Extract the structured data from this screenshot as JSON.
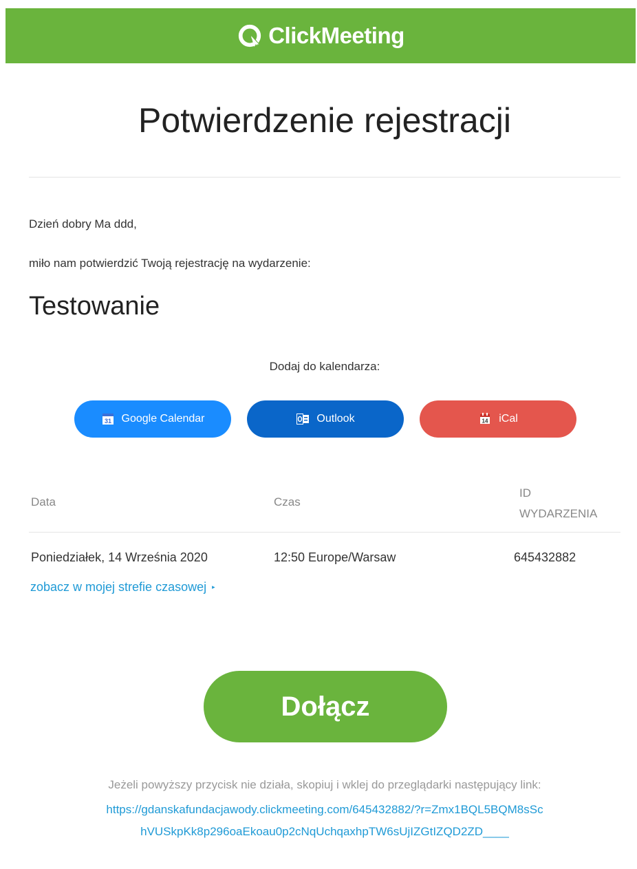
{
  "header": {
    "brand": "ClickMeeting",
    "brand_color": "#6ab43d"
  },
  "title": "Potwierdzenie rejestracji",
  "greeting": "Dzień dobry Ma ddd,",
  "intro": "miło nam potwierdzić Twoją rejestrację na wydarzenie:",
  "event_name": "Testowanie",
  "calendar": {
    "label": "Dodaj do kalendarza:",
    "buttons": [
      {
        "label": "Google Calendar",
        "icon": "google-calendar-icon",
        "color": "#1a8cff"
      },
      {
        "label": "Outlook",
        "icon": "outlook-icon",
        "color": "#0a66c9"
      },
      {
        "label": "iCal",
        "icon": "ical-icon",
        "color": "#e4564d"
      }
    ]
  },
  "table": {
    "headers": {
      "date": "Data",
      "time": "Czas",
      "id_line1": "ID",
      "id_line2": "WYDARZENIA"
    },
    "row": {
      "date": "Poniedziałek, 14 Września 2020",
      "time": "12:50 Europe/Warsaw",
      "id": "645432882"
    },
    "timezone_link": "zobacz w mojej strefie czasowej",
    "timezone_link_arrow": "▸"
  },
  "join": {
    "label": "Dołącz"
  },
  "fallback": {
    "note": "Jeżeli powyższy przycisk nie działa, skopiuj i wklej do przeglądarki następujący link:",
    "link": "https://gdanskafundacjawody.clickmeeting.com/645432882/?r=Zmx1BQL5BQM8sSchVUSkpKk8p296oaEkoau0p2cNqUchqaxhpTW6sUjIZGtIZQD2ZD____"
  }
}
